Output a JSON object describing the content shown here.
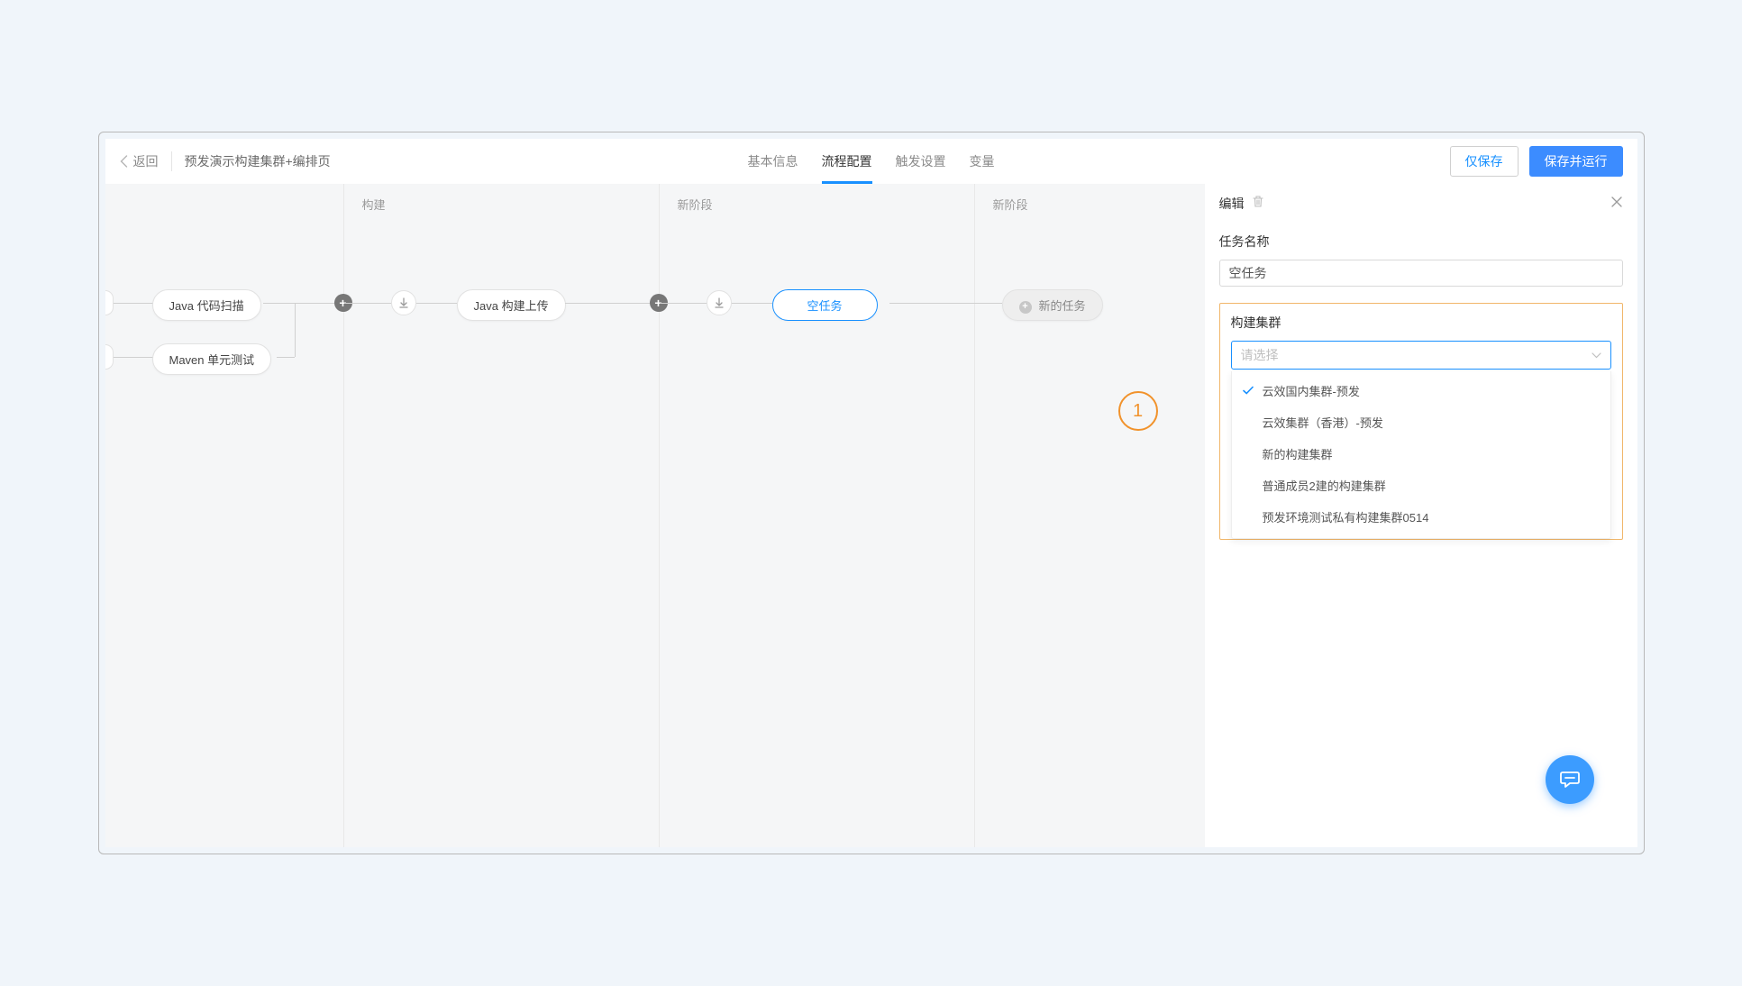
{
  "toolbar": {
    "back_label": "返回",
    "page_title": "预发演示构建集群+编排页",
    "tabs": [
      {
        "label": "基本信息",
        "active": false
      },
      {
        "label": "流程配置",
        "active": true
      },
      {
        "label": "触发设置",
        "active": false
      },
      {
        "label": "变量",
        "active": false
      }
    ],
    "save_label": "仅保存",
    "save_run_label": "保存并运行"
  },
  "stages": [
    {
      "header": "",
      "nodes": [
        {
          "label": "Java 代码扫描",
          "type": "normal"
        },
        {
          "label": "Maven 单元测试",
          "type": "normal"
        }
      ]
    },
    {
      "header": "构建",
      "nodes": [
        {
          "label": "Java 构建上传",
          "type": "normal"
        }
      ]
    },
    {
      "header": "新阶段",
      "nodes": [
        {
          "label": "空任务",
          "type": "selected"
        }
      ]
    },
    {
      "header": "新阶段",
      "nodes": [
        {
          "label": "新的任务",
          "type": "ghost"
        }
      ]
    }
  ],
  "panel": {
    "title": "编辑",
    "task_name_label": "任务名称",
    "task_name_value": "空任务",
    "cluster_label": "构建集群",
    "cluster_placeholder": "请选择",
    "cluster_options": [
      {
        "label": "云效国内集群-预发",
        "selected": true
      },
      {
        "label": "云效集群（香港）-预发",
        "selected": false
      },
      {
        "label": "新的构建集群",
        "selected": false
      },
      {
        "label": "普通成员2建的构建集群",
        "selected": false
      },
      {
        "label": "预发环境测试私有构建集群0514",
        "selected": false
      }
    ]
  },
  "annotation": {
    "number": "1"
  }
}
